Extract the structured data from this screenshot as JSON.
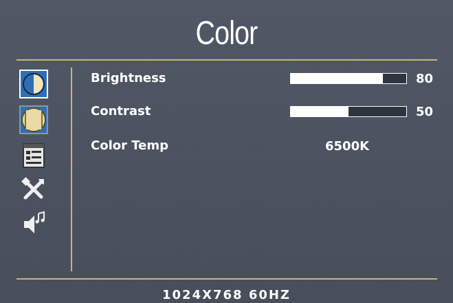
{
  "title": "Color",
  "menu": [
    {
      "icon": "brightness-contrast-icon",
      "selected": true
    },
    {
      "icon": "image-geometry-icon",
      "selected": false
    },
    {
      "icon": "osd-settings-icon",
      "selected": false
    },
    {
      "icon": "tools-icon",
      "selected": false
    },
    {
      "icon": "audio-icon",
      "selected": false
    }
  ],
  "settings": {
    "brightness": {
      "label": "Brightness",
      "value": 80,
      "value_text": "80"
    },
    "contrast": {
      "label": "Contrast",
      "value": 50,
      "value_text": "50"
    },
    "color_temp": {
      "label": "Color Temp",
      "value": "6500K"
    }
  },
  "footer": {
    "resolution": "1024X768  60HZ"
  },
  "colors": {
    "background": "#4b5360",
    "accent": "#c9b27c",
    "text": "#ffffff",
    "selected_icon_bg": "#2f6fb5"
  }
}
